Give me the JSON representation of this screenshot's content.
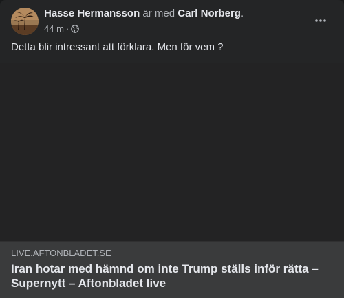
{
  "post": {
    "author": "Hasse Hermansson",
    "with_text": "är med",
    "tagged": "Carl Norberg",
    "period": ".",
    "time": "44 m",
    "separator": "·",
    "privacy_icon": "globe-icon",
    "more_icon": "more-options-icon",
    "text": "Detta blir intressant att förklara. Men för vem ?"
  },
  "link": {
    "domain": "LIVE.AFTONBLADET.SE",
    "title": "Iran hotar med hämnd om inte Trump ställs inför rätta – Supernytt – Aftonbladet live"
  },
  "colors": {
    "card_bg": "#242526",
    "preview_bg": "#3a3b3c",
    "primary_text": "#e4e6eb",
    "secondary_text": "#b0b3b8"
  }
}
